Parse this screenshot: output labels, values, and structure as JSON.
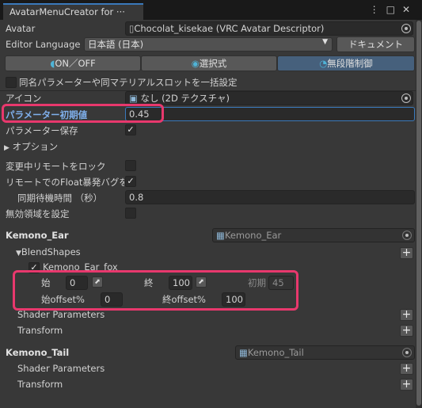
{
  "window": {
    "tab_title": "AvatarMenuCreator for ···",
    "icons": [
      "menu-dots",
      "maximize",
      "close"
    ]
  },
  "avatar": {
    "label": "Avatar",
    "value": "Chocolat_kisekae (VRC Avatar Descriptor)"
  },
  "editor_language": {
    "label": "Editor Language",
    "value": "日本語 (日本)",
    "doc_button": "ドキュメント"
  },
  "mode_tabs": [
    {
      "label": "ON／OFF",
      "selected": false
    },
    {
      "label": "選択式",
      "selected": false
    },
    {
      "label": "無段階制御",
      "selected": true
    }
  ],
  "bulk_option": {
    "label": "同名パラメーターや同マテリアルスロットを一括設定",
    "checked": false
  },
  "icon_field": {
    "label": "アイコン",
    "value": "なし (2D テクスチャ)"
  },
  "param_default": {
    "label": "パラメーター初期値",
    "value": "0.45"
  },
  "param_save": {
    "label": "パラメーター保存",
    "checked": true
  },
  "options_foldout": "オプション",
  "remote_lock": {
    "label": "変更中リモートをロック",
    "checked": false
  },
  "float_bug": {
    "label": "リモートでのFloat暴発バグを防ぐ",
    "checked": true
  },
  "sync_wait": {
    "label": "同期待機時間 （秒）",
    "value": "0.8"
  },
  "invalid_region": {
    "label": "無効領域を設定",
    "checked": false
  },
  "ear": {
    "title": "Kemono_Ear",
    "object_field": "Kemono_Ear",
    "blendshapes_label": "BlendShapes",
    "shape_name": "Kemono_Ear_fox",
    "start_label": "始",
    "start_value": "0",
    "end_label": "終",
    "end_value": "100",
    "initial_label": "初期",
    "initial_value": "45",
    "start_offset_label": "始offset%",
    "start_offset_value": "0",
    "end_offset_label": "終offset%",
    "end_offset_value": "100",
    "shader_params": "Shader Parameters",
    "transform": "Transform"
  },
  "tail": {
    "title": "Kemono_Tail",
    "object_field": "Kemono_Tail",
    "shader_params": "Shader Parameters",
    "transform": "Transform"
  },
  "colors": {
    "accent": "#3a79bb",
    "highlight": "#e8386d",
    "selected_tab": "#46607c"
  }
}
